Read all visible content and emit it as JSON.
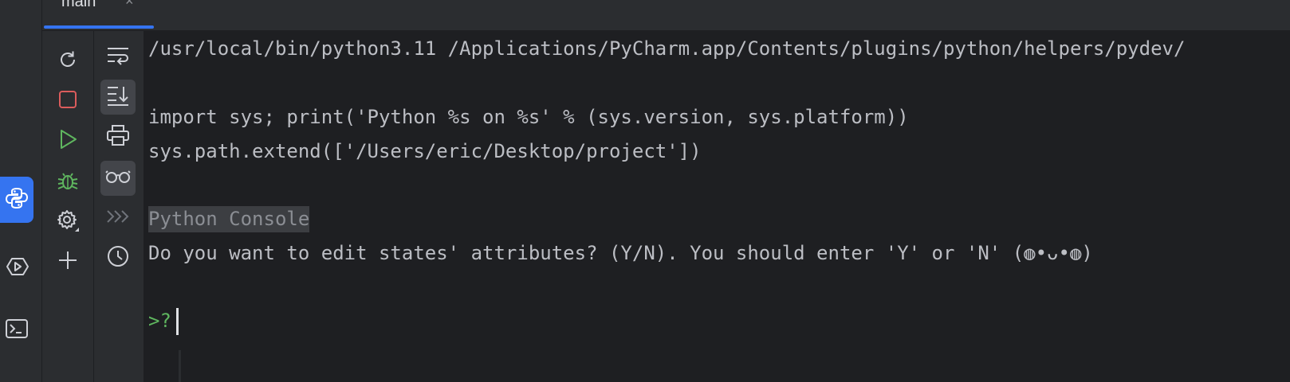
{
  "tab": {
    "label": "main",
    "close": "×"
  },
  "stripe": {
    "items": [
      {
        "icon": "python-console-icon",
        "active": true
      },
      {
        "icon": "services-icon",
        "active": false
      },
      {
        "icon": "terminal-icon",
        "active": false
      }
    ]
  },
  "toolbar": {
    "col1": [
      "rerun-icon",
      "stop-icon",
      "run-icon",
      "debug-icon",
      "settings-icon",
      "add-icon"
    ],
    "col2": [
      "soft-wrap-icon",
      "scroll-to-end-icon",
      "print-icon",
      "show-variables-icon",
      "command-queue-icon",
      "history-icon"
    ],
    "col2_chevrons": "»"
  },
  "console": {
    "command_line": "/usr/local/bin/python3.11 /Applications/PyCharm.app/Contents/plugins/python/helpers/pydev/",
    "import_line": "import sys; print('Python %s on %s' % (sys.version, sys.platform))",
    "path_line": "sys.path.extend(['/Users/eric/Desktop/project'])",
    "label": "Python Console",
    "question": "Do you want to edit states' attributes? (Y/N). You should enter 'Y' or 'N' (◍•ᴗ•◍)",
    "prompt": ">?"
  },
  "colors": {
    "background": "#1e1f22",
    "panel": "#2b2d30",
    "accent": "#3574f0",
    "text": "#bcbec4",
    "prompt": "#5fb65f",
    "stop": "#db5c5c",
    "run": "#5fb65f"
  }
}
